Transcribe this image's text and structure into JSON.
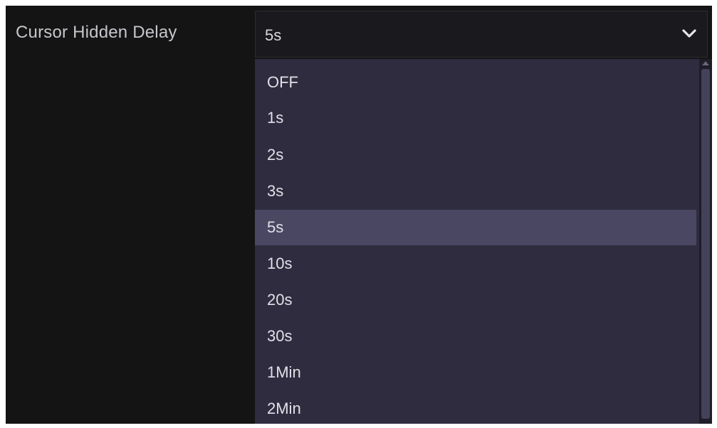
{
  "setting": {
    "label": "Cursor Hidden Delay",
    "selected_value": "5s",
    "icon": "chevron-down-icon"
  },
  "dropdown": {
    "options": [
      "OFF",
      "1s",
      "2s",
      "3s",
      "5s",
      "10s",
      "20s",
      "30s",
      "1Min",
      "2Min"
    ],
    "selected_index": 4
  },
  "colors": {
    "background": "#141414",
    "dropdown_bg": "#302c40",
    "selected_bg": "#4a4762",
    "text": "#e0e0e6"
  }
}
